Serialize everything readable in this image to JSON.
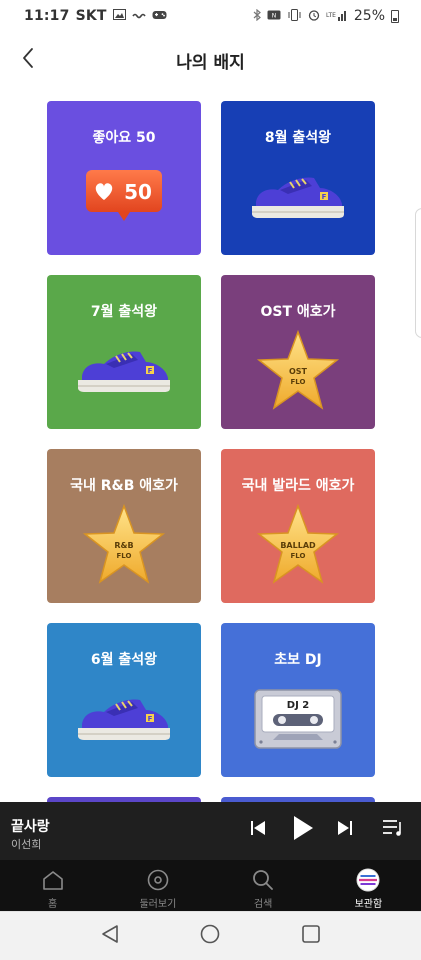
{
  "status_bar": {
    "time": "11:17",
    "carrier": "SKT",
    "battery": "25%",
    "icons": [
      "image-icon",
      "link-icon",
      "gamepad-icon",
      "bluetooth-icon",
      "nfc-icon",
      "vibrate-icon",
      "alarm-icon",
      "signal-icon",
      "battery-icon"
    ]
  },
  "header": {
    "title": "나의 배지",
    "back_icon": "chevron-left-icon"
  },
  "badges": [
    {
      "title": "좋아요 50",
      "color": "#6a4fe0",
      "art": "like-bubble",
      "art_text": "50"
    },
    {
      "title": "8월 출석왕",
      "color": "#173fb5",
      "art": "sneaker"
    },
    {
      "title": "7월 출석왕",
      "color": "#5aa84a",
      "art": "sneaker"
    },
    {
      "title": "OST 애호가",
      "color": "#7a3f7c",
      "art": "star",
      "art_text": [
        "OST",
        "FLO"
      ]
    },
    {
      "title": "국내 R&B 애호가",
      "color": "#a77e60",
      "art": "star",
      "art_text": [
        "R&B",
        "FLO"
      ]
    },
    {
      "title": "국내 발라드 애호가",
      "color": "#df6a5f",
      "art": "star",
      "art_text": [
        "BALLAD",
        "FLO"
      ]
    },
    {
      "title": "6월 출석왕",
      "color": "#2f86c8",
      "art": "sneaker"
    },
    {
      "title": "초보 DJ",
      "color": "#4570d8",
      "art": "cassette",
      "art_text": "DJ 2"
    }
  ],
  "more_cards": [
    {
      "color": "#5b46c8"
    },
    {
      "color": "#4a5bd0"
    }
  ],
  "player": {
    "title": "끝사랑",
    "artist": "이선희"
  },
  "bottom_nav": {
    "items": [
      {
        "label": "홈",
        "icon": "home-icon",
        "active": false
      },
      {
        "label": "둘러보기",
        "icon": "disc-icon",
        "active": false
      },
      {
        "label": "검색",
        "icon": "search-icon",
        "active": false
      },
      {
        "label": "보관함",
        "icon": "library-avatar-icon",
        "active": true
      }
    ]
  },
  "colors": {
    "player_bg": "#1f1f1f",
    "nav_bg": "#111111",
    "star_gold": "#f6c84e"
  }
}
